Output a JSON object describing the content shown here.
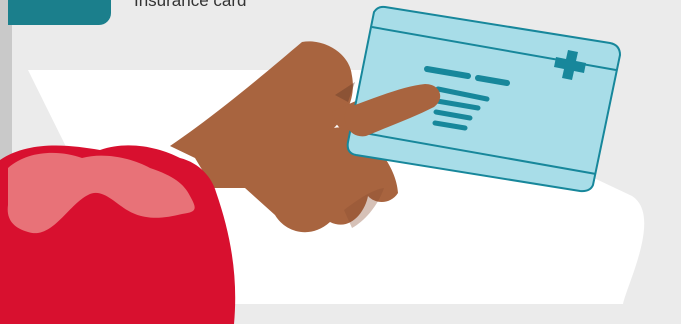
{
  "step": {
    "caption": "Insurance card"
  },
  "colors": {
    "background": "#ebebeb",
    "panel": "#ffffff",
    "badge": "#1b7f8c",
    "card": "#a8dde8",
    "card_accent": "#17879b",
    "skin": "#a8643f",
    "sleeve": "#d8102f",
    "sleeve_highlight": "#e87278"
  },
  "icons": [
    "plus-cross-icon"
  ]
}
